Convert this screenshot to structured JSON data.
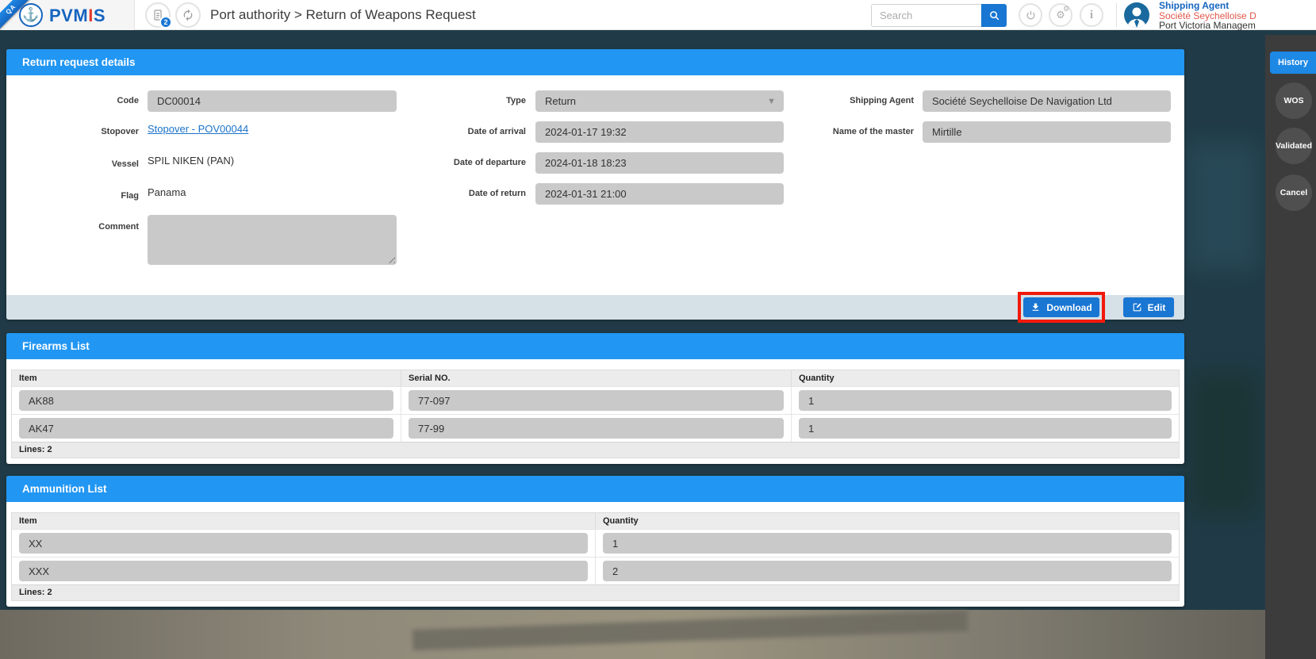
{
  "colors": {
    "accent_blue": "#2196f3",
    "button_blue": "#1976d2",
    "link_blue": "#1a73c7",
    "annotation_red": "#f2190a",
    "brand_blue": "#1565c0",
    "brand_red": "#e23b2e",
    "company_red": "#e2574b",
    "sidebar_dark": "#3c3c3c",
    "input_grey": "#c9c9c9",
    "footer_bar": "#d6e0e7"
  },
  "header": {
    "qa_ribbon": "QA",
    "brand": {
      "part1": "PVM",
      "part2": "I",
      "part3": "S"
    },
    "documents_badge": "2",
    "breadcrumb": "Port authority > Return of Weapons Request",
    "search_placeholder": "Search",
    "user": {
      "role": "Shipping Agent",
      "company": "Société Seychelloise D",
      "org": "Port Victoria Managem"
    }
  },
  "sidebar": {
    "history_label": "History",
    "buttons": [
      "WOS",
      "Validated",
      "Cancel"
    ]
  },
  "details": {
    "title": "Return request details",
    "code_label": "Code",
    "code_value": "DC00014",
    "stopover_label": "Stopover",
    "stopover_link": "Stopover - POV00044",
    "vessel_label": "Vessel",
    "vessel_value": "SPIL NIKEN (PAN)",
    "flag_label": "Flag",
    "flag_value": "Panama",
    "comment_label": "Comment",
    "comment_value": "",
    "type_label": "Type",
    "type_value": "Return",
    "arrival_label": "Date of arrival",
    "arrival_value": "2024-01-17 19:32",
    "departure_label": "Date of departure",
    "departure_value": "2024-01-18 18:23",
    "return_label": "Date of return",
    "return_value": "2024-01-31 21:00",
    "agent_label": "Shipping Agent",
    "agent_value": "Société Seychelloise De Navigation Ltd",
    "master_label": "Name of the master",
    "master_value": "Mirtille",
    "download_label": "Download",
    "edit_label": "Edit"
  },
  "firearms": {
    "title": "Firearms List",
    "columns": [
      "Item",
      "Serial NO.",
      "Quantity"
    ],
    "rows": [
      [
        "AK88",
        "77-097",
        "1"
      ],
      [
        "AK47",
        "77-99",
        "1"
      ]
    ],
    "footer": "Lines: 2"
  },
  "ammunition": {
    "title": "Ammunition List",
    "columns": [
      "Item",
      "Quantity"
    ],
    "rows": [
      [
        "XX",
        "1"
      ],
      [
        "XXX",
        "2"
      ]
    ],
    "footer": "Lines: 2"
  }
}
